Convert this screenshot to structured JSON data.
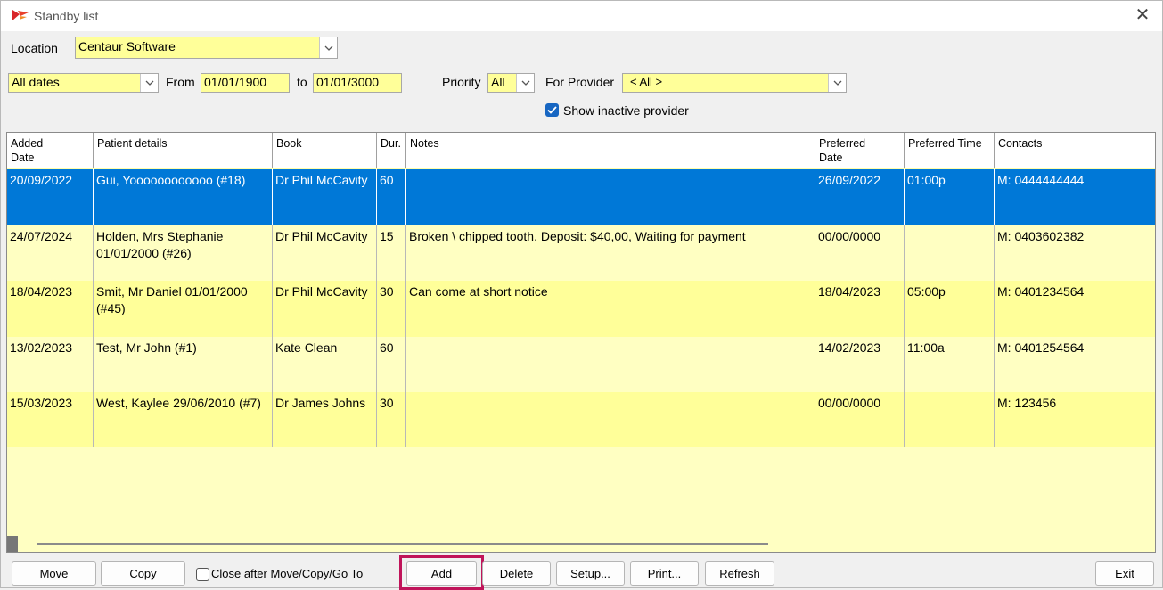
{
  "window": {
    "title": "Standby list"
  },
  "filters": {
    "location_label": "Location",
    "location_value": "Centaur Software",
    "date_range_value": "All dates",
    "from_label": "From",
    "from_value": "01/01/1900",
    "to_label": "to",
    "to_value": "01/01/3000",
    "priority_label": "Priority",
    "priority_value": "All",
    "provider_label": "For Provider",
    "provider_value": "< All >",
    "show_inactive_label": "Show inactive provider",
    "show_inactive_checked": true
  },
  "grid": {
    "columns": [
      {
        "line1": "Added",
        "line2": "Date"
      },
      {
        "line1": "Patient details",
        "line2": ""
      },
      {
        "line1": "Book",
        "line2": ""
      },
      {
        "line1": "Dur.",
        "line2": ""
      },
      {
        "line1": "Notes",
        "line2": ""
      },
      {
        "line1": "Preferred",
        "line2": "Date"
      },
      {
        "line1": "Preferred Time",
        "line2": ""
      },
      {
        "line1": "Contacts",
        "line2": ""
      }
    ],
    "rows": [
      {
        "added": "20/09/2022",
        "patient": "Gui, Yoooooooooooo (#18)",
        "book": "Dr Phil McCavity",
        "dur": "60",
        "notes": "",
        "pref_date": "26/09/2022",
        "pref_time": "01:00p",
        "contacts": "M: 0444444444",
        "selected": true
      },
      {
        "added": "24/07/2024",
        "patient": "Holden, Mrs Stephanie 01/01/2000 (#26)",
        "book": "Dr Phil McCavity",
        "dur": "15",
        "notes": "Broken \\ chipped tooth.  Deposit: $40,00, Waiting for payment",
        "pref_date": "00/00/0000",
        "pref_time": "",
        "contacts": "M: 0403602382",
        "selected": false
      },
      {
        "added": "18/04/2023",
        "patient": "Smit, Mr Daniel 01/01/2000 (#45)",
        "book": "Dr Phil McCavity",
        "dur": "30",
        "notes": "Can come at short notice",
        "pref_date": "18/04/2023",
        "pref_time": "05:00p",
        "contacts": "M: 0401234564",
        "selected": false
      },
      {
        "added": "13/02/2023",
        "patient": "Test, Mr John (#1)",
        "book": "Kate Clean",
        "dur": "60",
        "notes": "",
        "pref_date": "14/02/2023",
        "pref_time": "11:00a",
        "contacts": "M: 0401254564",
        "selected": false
      },
      {
        "added": "15/03/2023",
        "patient": "West, Kaylee 29/06/2010 (#7)",
        "book": "Dr James Johns",
        "dur": "30",
        "notes": "",
        "pref_date": "00/00/0000",
        "pref_time": "",
        "contacts": "M: 123456",
        "selected": false
      }
    ]
  },
  "footer": {
    "move_label": "Move",
    "copy_label": "Copy",
    "close_after_label": "Close after Move/Copy/Go To",
    "close_after_checked": false,
    "add_label": "Add",
    "delete_label": "Delete",
    "setup_label": "Setup...",
    "print_label": "Print...",
    "refresh_label": "Refresh",
    "exit_label": "Exit"
  },
  "colors": {
    "field_yellow": "#ffff99",
    "row_light": "#ffffc2",
    "row_dark": "#ffff99",
    "selection": "#0078d7",
    "highlight": "#c0145a"
  }
}
